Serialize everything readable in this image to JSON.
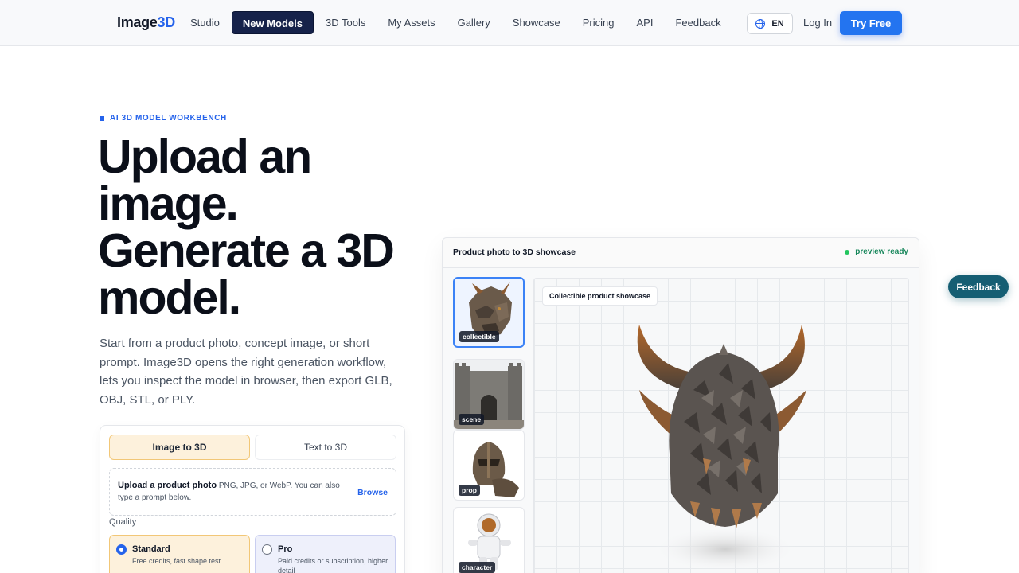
{
  "header": {
    "logo_main": "Image",
    "logo_accent": "3D",
    "nav": [
      {
        "label": "Studio"
      },
      {
        "label": "New Models"
      },
      {
        "label": "3D Tools"
      },
      {
        "label": "My Assets"
      },
      {
        "label": "Gallery"
      },
      {
        "label": "Showcase"
      },
      {
        "label": "Pricing"
      },
      {
        "label": "API"
      },
      {
        "label": "Feedback"
      }
    ],
    "active_nav": "New Models",
    "language": "EN",
    "login": "Log In",
    "cta": "Try Free"
  },
  "hero": {
    "eyebrow": "AI 3D MODEL WORKBENCH",
    "headline_lines": [
      "Upload an",
      "image.",
      "Generate a 3D",
      "model."
    ],
    "subtitle": "Start from a product photo, concept image, or short prompt. Image3D opens the right generation workflow, lets you inspect the model in browser, then export GLB, OBJ, STL, or PLY."
  },
  "workflow": {
    "tabs": [
      {
        "label": "Image to 3D",
        "active": true
      },
      {
        "label": "Text to 3D",
        "active": false
      }
    ],
    "upload": {
      "title": "Upload a product photo",
      "hint": "PNG, JPG, or WebP. You can also type a prompt below.",
      "browse": "Browse"
    },
    "quality_label": "Quality",
    "quality_options": [
      {
        "title": "Standard",
        "desc": "Free credits, fast shape test",
        "selected": true
      },
      {
        "title": "Pro",
        "desc": "Paid credits or subscription, higher detail",
        "selected": false
      }
    ]
  },
  "showcase": {
    "title": "Product photo to 3D showcase",
    "status": "preview ready",
    "viewer_tag": "Collectible product showcase",
    "thumbnails": [
      {
        "label": "collectible",
        "selected": true
      },
      {
        "label": "scene",
        "selected": false
      },
      {
        "label": "prop",
        "selected": false
      },
      {
        "label": "character",
        "selected": false
      }
    ]
  },
  "floating_feedback": "Feedback",
  "colors": {
    "accent": "#2563eb",
    "nav_active": "#16224a",
    "tab_active_bg": "#fdf1dc",
    "status_green": "#16865a",
    "feedback_bg": "#155e73"
  }
}
